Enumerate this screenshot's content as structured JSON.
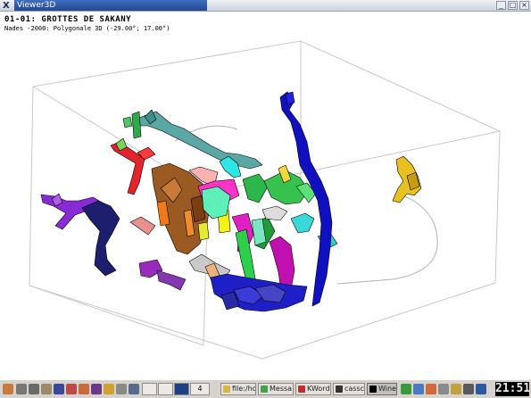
{
  "window": {
    "close_glyph": "X",
    "title": "Viewer3D",
    "controls": [
      "_",
      "□",
      "×"
    ]
  },
  "cave": {
    "title": "01-01: GROTTES DE SAKANY",
    "subtitle": "Nades -2000: Polygonale 3D (-29.00°; 17.00°)"
  },
  "taskbar": {
    "pager_number": "4",
    "tasks": [
      {
        "label": "file:/ho",
        "icon": "folder-icon",
        "color": "#d9b64a"
      },
      {
        "label": "Messa",
        "icon": "chat-icon",
        "color": "#4aa04a"
      },
      {
        "label": "KWord",
        "icon": "kword-icon",
        "color": "#c03030"
      },
      {
        "label": "cassc",
        "icon": "terminal-icon",
        "color": "#333333"
      },
      {
        "label": "Wine",
        "icon": "wine-icon",
        "color": "#000000"
      }
    ],
    "clock": "21:51"
  },
  "colors": {
    "titlebar_active": "#22478e",
    "box_lines": "#c8c8c8"
  }
}
